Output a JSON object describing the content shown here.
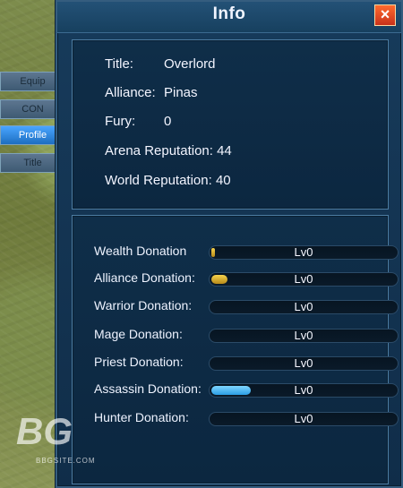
{
  "window": {
    "title": "Info",
    "close_label": "×"
  },
  "tabs": [
    {
      "label": "Equip",
      "active": false
    },
    {
      "label": "CON",
      "active": false
    },
    {
      "label": "Profile",
      "active": true
    },
    {
      "label": "Title",
      "active": false
    }
  ],
  "profile": {
    "title_label": "Title:",
    "title_value": "Overlord",
    "alliance_label": "Alliance:",
    "alliance_value": "Pinas",
    "fury_label": "Fury:",
    "fury_value": "0",
    "arena_label": "Arena Reputation:",
    "arena_value": "44",
    "world_label": "World Reputation:",
    "world_value": "40"
  },
  "donations": [
    {
      "label": "Wealth Donation",
      "level": "Lv0",
      "fill": 0.02,
      "color": "gold"
    },
    {
      "label": "Alliance Donation:",
      "level": "Lv0",
      "fill": 0.08,
      "color": "gold"
    },
    {
      "label": "Warrior Donation:",
      "level": "Lv0",
      "fill": 0.0,
      "color": "none"
    },
    {
      "label": "Mage Donation:",
      "level": "Lv0",
      "fill": 0.0,
      "color": "none"
    },
    {
      "label": "Priest Donation:",
      "level": "Lv0",
      "fill": 0.0,
      "color": "none"
    },
    {
      "label": "Assassin Donation:",
      "level": "Lv0",
      "fill": 0.22,
      "color": "blue"
    },
    {
      "label": "Hunter Donation:",
      "level": "Lv0",
      "fill": 0.0,
      "color": "none"
    }
  ],
  "watermark": {
    "big": "BG",
    "small": "BBGSITE.COM"
  }
}
